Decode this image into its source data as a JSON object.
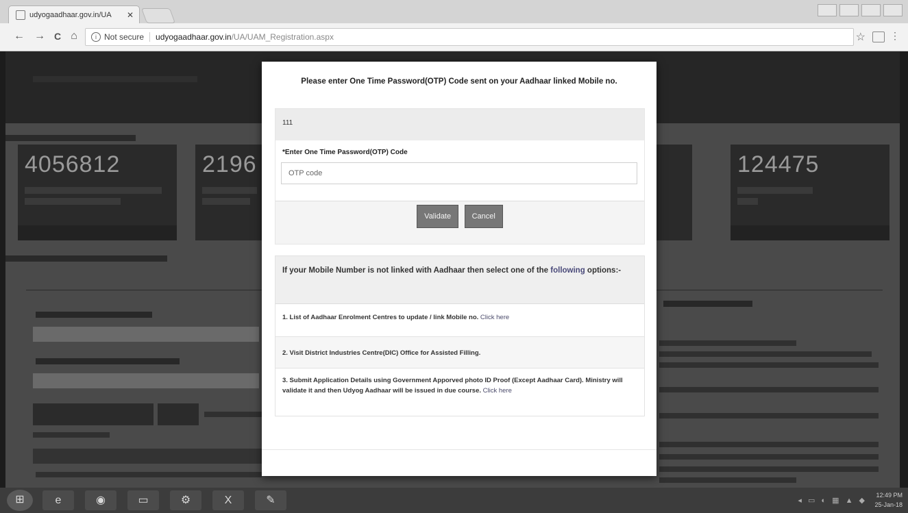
{
  "browser": {
    "tab_title": "udyogaadhaar.gov.in/UA",
    "tab_close": "✕",
    "security_label": "Not secure",
    "url_host": "udyogaadhaar.gov.in",
    "url_path": "/UA/UAM_Registration.aspx",
    "back_glyph": "←",
    "forward_glyph": "→",
    "reload_glyph": "C",
    "home_glyph": "⌂",
    "star_glyph": "☆",
    "menu_glyph": "⋮"
  },
  "background_page": {
    "stats": [
      {
        "value": "4056812"
      },
      {
        "value": "2196"
      },
      {
        "value": "124475"
      }
    ]
  },
  "modal": {
    "header": "Please enter One Time Password(OTP) Code sent on your Aadhaar linked Mobile no.",
    "masked_mobile": "111",
    "otp_label": "*Enter One Time Password(OTP) Code",
    "otp_placeholder": "OTP code",
    "validate_label": "Validate",
    "cancel_label": "Cancel",
    "alt_heading_prefix": "If your Mobile Number is not linked with Aadhaar then select one of the ",
    "alt_heading_link": "following",
    "alt_heading_suffix": " options:-",
    "option1_text": "1. List of Aadhaar Enrolment Centres to update / link Mobile no. ",
    "option1_link": "Click here",
    "option2_text": "2. Visit District Industries Centre(DIC) Office for Assisted Filling.",
    "option3_text": "3. Submit Application Details using Government Apporved photo ID Proof (Except Aadhaar Card). Ministry will validate it and then Udyog Aadhaar will be issued in due course. ",
    "option3_link": "Click here"
  },
  "taskbar": {
    "clock_time": "12:49 PM",
    "clock_date": "25-Jan-18"
  }
}
